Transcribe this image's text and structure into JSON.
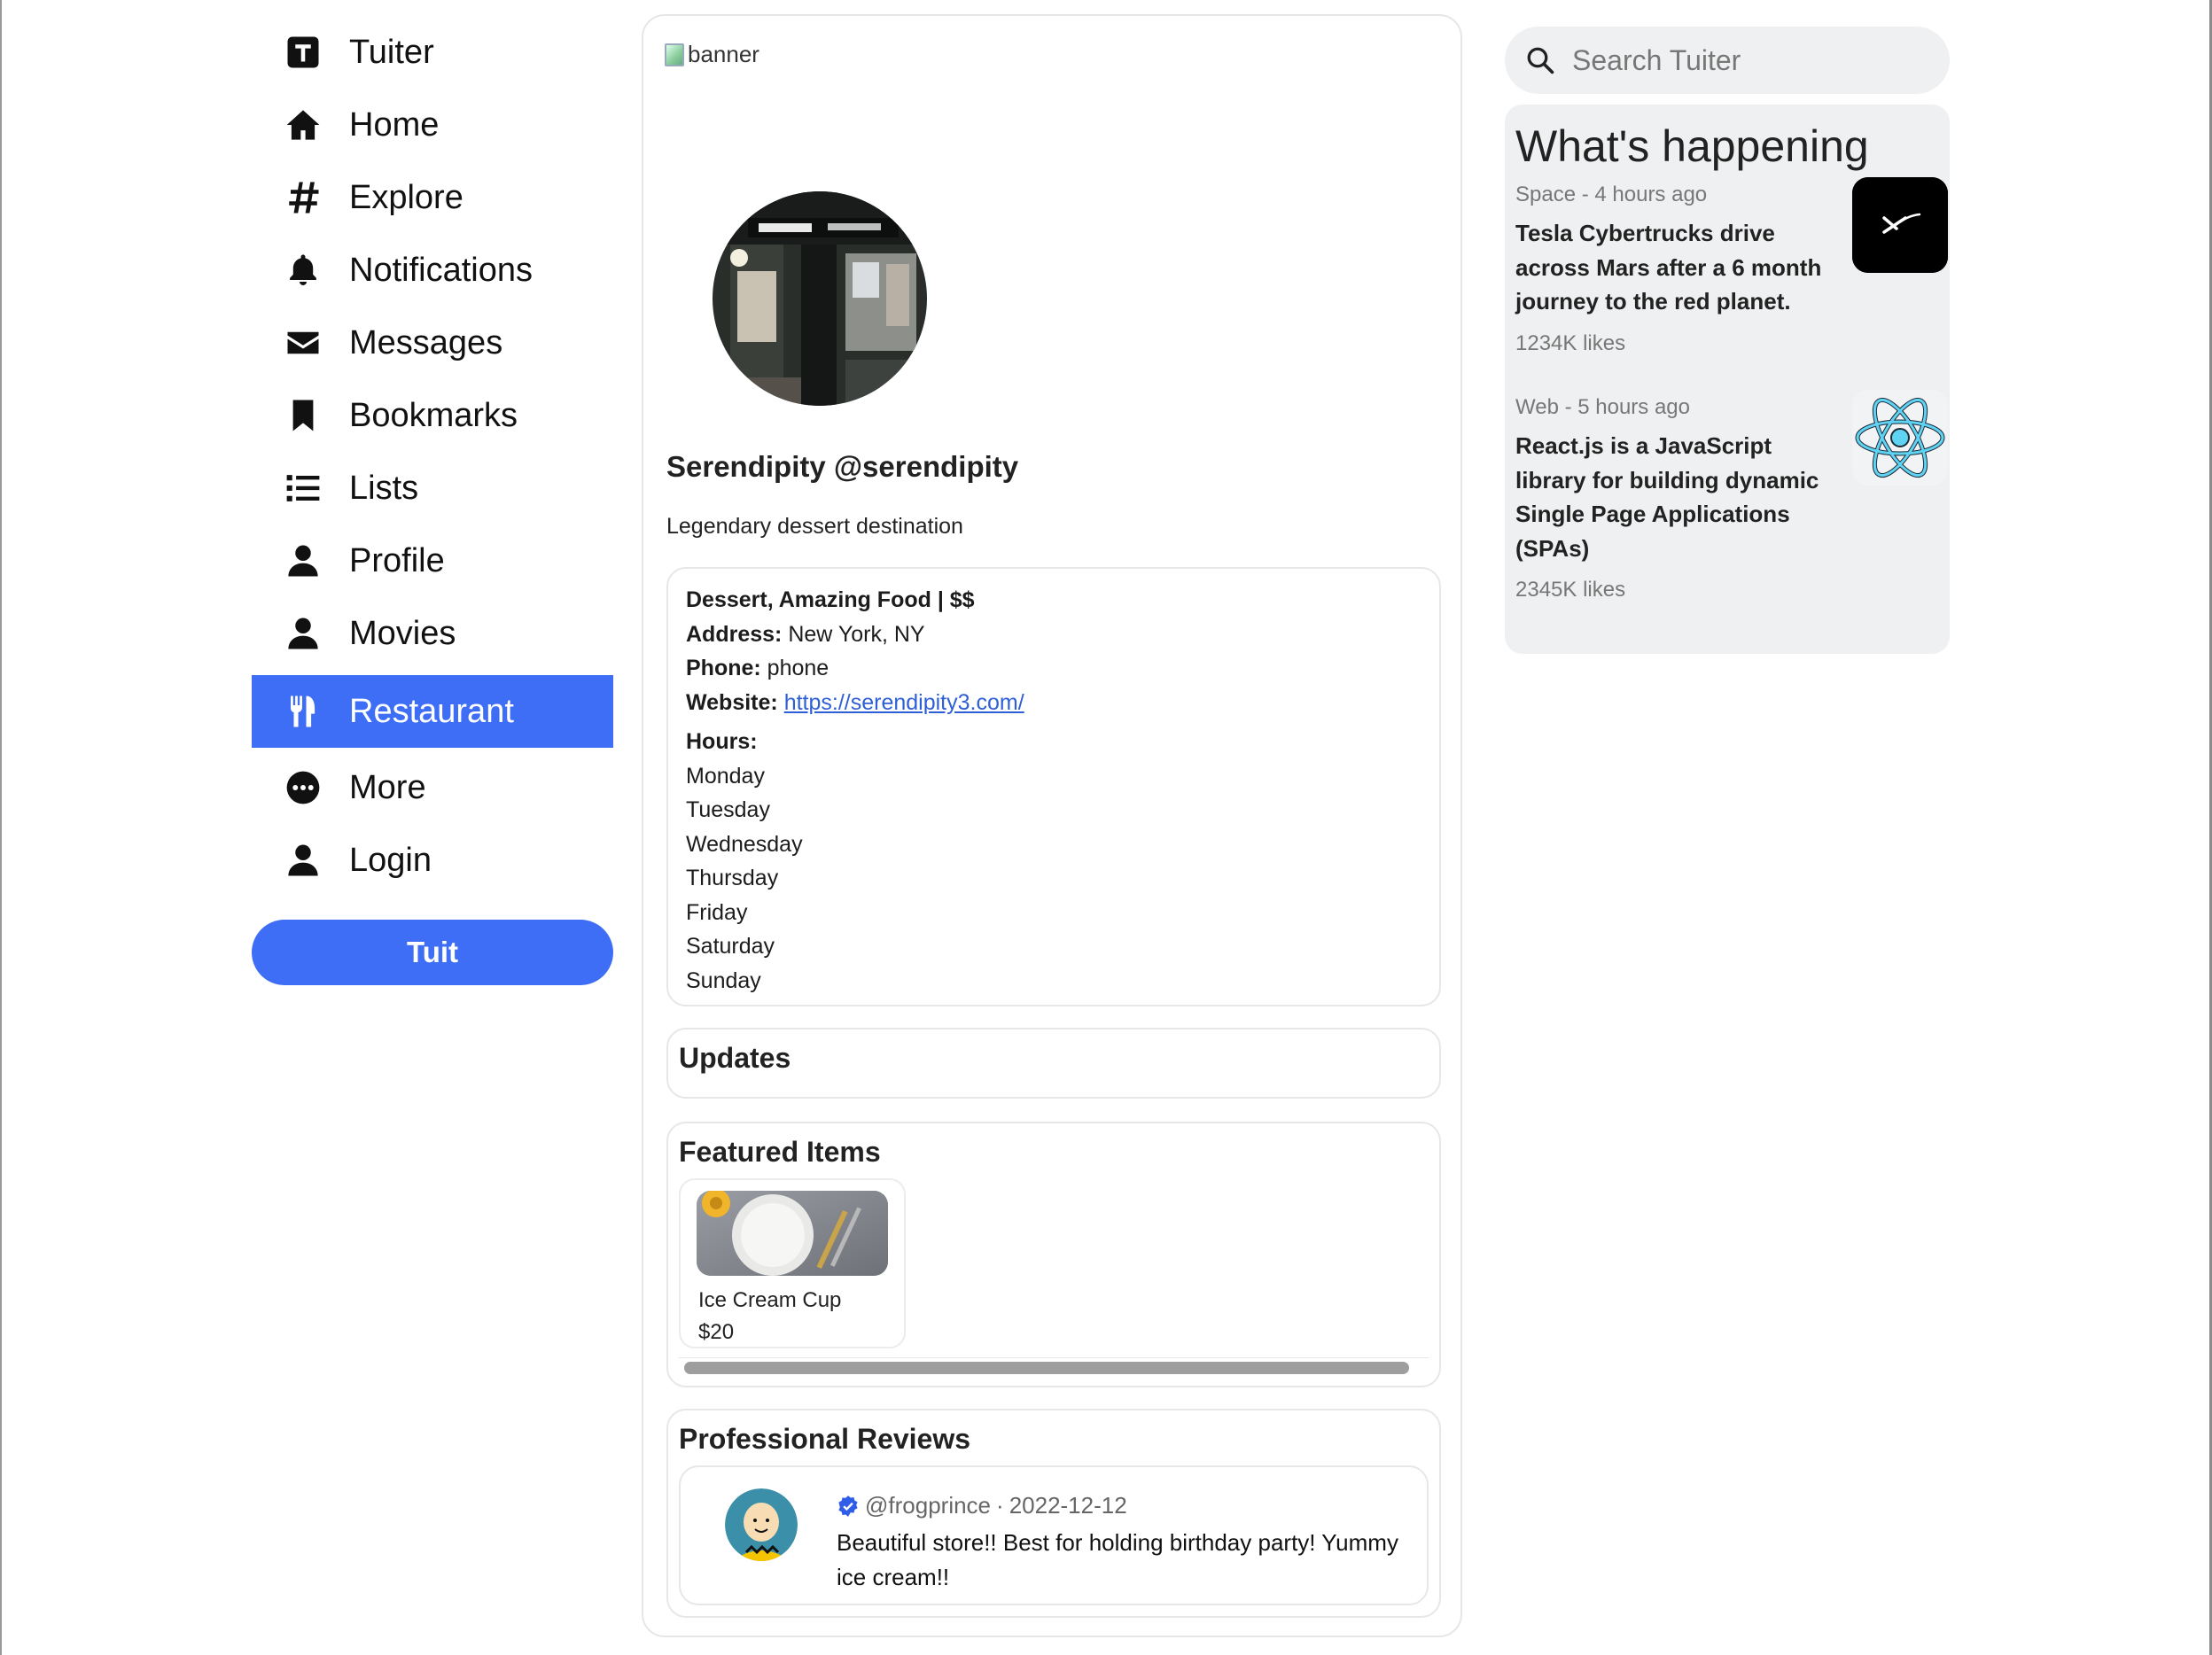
{
  "nav": {
    "items": [
      {
        "label": "Tuiter",
        "icon": "tuiter-logo-icon",
        "active": false
      },
      {
        "label": "Home",
        "icon": "home-icon",
        "active": false
      },
      {
        "label": "Explore",
        "icon": "hashtag-icon",
        "active": false
      },
      {
        "label": "Notifications",
        "icon": "bell-icon",
        "active": false
      },
      {
        "label": "Messages",
        "icon": "envelope-icon",
        "active": false
      },
      {
        "label": "Bookmarks",
        "icon": "bookmark-icon",
        "active": false
      },
      {
        "label": "Lists",
        "icon": "list-icon",
        "active": false
      },
      {
        "label": "Profile",
        "icon": "user-icon",
        "active": false
      },
      {
        "label": "Movies",
        "icon": "user-icon",
        "active": false
      },
      {
        "label": "Restaurant",
        "icon": "utensils-icon",
        "active": true
      },
      {
        "label": "More",
        "icon": "ellipsis-circle-icon",
        "active": false
      },
      {
        "label": "Login",
        "icon": "user-icon",
        "active": false
      }
    ],
    "tuit_button": "Tuit",
    "active_color": "#3d6ef5"
  },
  "profile": {
    "banner_alt": "banner",
    "name_handle": "Serendipity @serendipity",
    "bio": "Legendary dessert destination"
  },
  "info": {
    "category": "Dessert, Amazing Food | $$",
    "address_label": "Address:",
    "address": "New York, NY",
    "phone_label": "Phone:",
    "phone": "phone",
    "website_label": "Website:",
    "website": "https://serendipity3.com/",
    "hours_label": "Hours:",
    "days": [
      "Monday",
      "Tuesday",
      "Wednesday",
      "Thursday",
      "Friday",
      "Saturday",
      "Sunday"
    ]
  },
  "updates": {
    "title": "Updates"
  },
  "featured": {
    "title": "Featured Items",
    "items": [
      {
        "name": "Ice Cream Cup",
        "price": "$20"
      }
    ]
  },
  "reviews": {
    "title": "Professional Reviews",
    "items": [
      {
        "handle": "@frogprince",
        "separator": "·",
        "date": "2022-12-12",
        "text": "Beautiful store!! Best for holding birthday party! Yummy ice cream!!"
      }
    ]
  },
  "search": {
    "placeholder": "Search Tuiter"
  },
  "happening": {
    "title": "What's happening",
    "news": [
      {
        "meta": "Space - 4 hours ago",
        "title": "Tesla Cybertrucks drive across Mars after a 6 month journey to the red planet.",
        "likes": "1234K likes",
        "image": "spacex-logo-icon"
      },
      {
        "meta": "Web - 5 hours ago",
        "title": "React.js is a JavaScript library for building dynamic Single Page Applications (SPAs)",
        "likes": "2345K likes",
        "image": "react-logo-icon"
      }
    ]
  }
}
